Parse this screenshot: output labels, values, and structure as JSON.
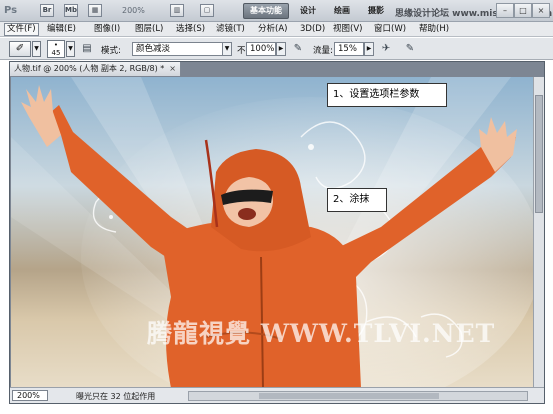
{
  "app": {
    "logo": "Ps",
    "zoom": "200%",
    "workspaces": [
      "基本功能",
      "设计",
      "绘画",
      "摄影"
    ],
    "active_workspace": "基本功能",
    "top_watermark": "思缘设计论坛 www.missyuan.com",
    "window_controls": [
      "–",
      "□",
      "×"
    ]
  },
  "menu": {
    "items": [
      "文件(F)",
      "编辑(E)",
      "图像(I)",
      "图层(L)",
      "选择(S)",
      "滤镜(T)",
      "分析(A)",
      "3D(D)",
      "视图(V)",
      "窗口(W)",
      "帮助(H)"
    ],
    "active": "文件(F)"
  },
  "options": {
    "brush_size": "45",
    "mode_label": "模式:",
    "mode_value": "颜色减淡",
    "opacity_label": "不透明度:",
    "opacity_value": "100%",
    "flow_label": "流量:",
    "flow_value": "15%"
  },
  "document": {
    "tab_title": "人物.tif @ 200% (人物 副本 2, RGB/8) *",
    "close": "×",
    "zoom": "200%",
    "status": "曝光只在 32 位起作用"
  },
  "annotations": {
    "step1": "1、设置选项栏参数",
    "step2": "2、涂抹"
  },
  "watermark": "腾龍視覺 WWW.TLVI.NET",
  "colors": {
    "accent_active_workspace": "#6b747e",
    "hoodie": "#e0622a",
    "sky": "#8fb3cf"
  }
}
